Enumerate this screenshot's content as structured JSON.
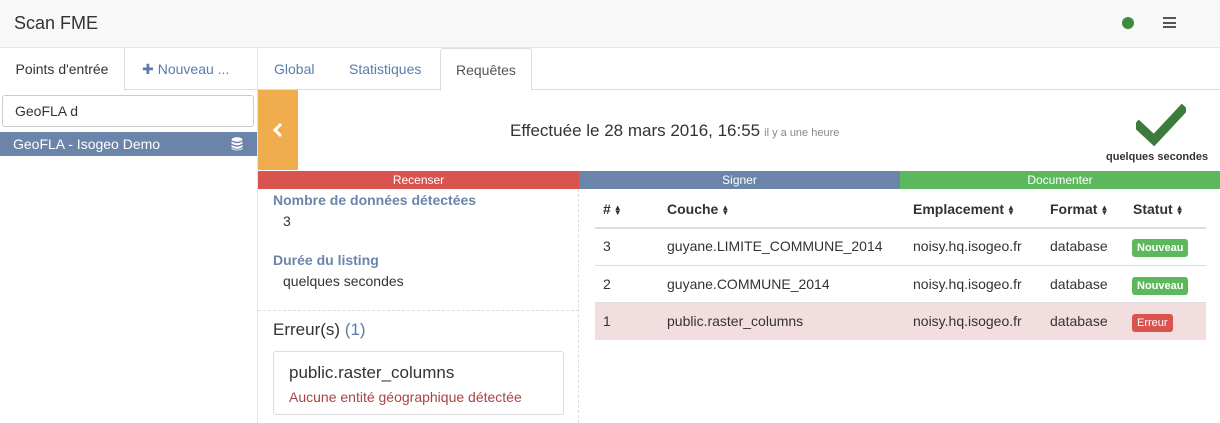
{
  "app": {
    "title": "Scan FME"
  },
  "sidebar": {
    "tabs": [
      {
        "label": "Points d'entrée"
      },
      {
        "label": "Nouveau ..."
      }
    ],
    "search": {
      "value": "GeoFLA d"
    },
    "items": [
      {
        "label": "GeoFLA - Isogeo Demo"
      }
    ]
  },
  "tabs": [
    {
      "label": "Global"
    },
    {
      "label": "Statistiques"
    },
    {
      "label": "Requêtes"
    }
  ],
  "banner": {
    "title": "Effectuée le 28 mars 2016, 16:55",
    "ago": "il y a une heure",
    "duration": "quelques secondes"
  },
  "steps": [
    {
      "label": "Recenser",
      "color": "#d9534f"
    },
    {
      "label": "Signer",
      "color": "#6b85aa"
    },
    {
      "label": "Documenter",
      "color": "#5cb85c"
    }
  ],
  "details": {
    "detected_label": "Nombre de données détectées",
    "detected_value": "3",
    "listing_label": "Durée du listing",
    "listing_value": "quelques secondes"
  },
  "errors": {
    "heading": "Erreur(s)",
    "count": "(1)",
    "items": [
      {
        "title": "public.raster_columns",
        "message": "Aucune entité géographique détectée"
      }
    ]
  },
  "table": {
    "headers": [
      "#",
      "Couche",
      "Emplacement",
      "Format",
      "Statut"
    ],
    "rows": [
      {
        "num": "3",
        "layer": "guyane.LIMITE_COMMUNE_2014",
        "location": "noisy.hq.isogeo.fr",
        "format": "database",
        "status": "Nouveau"
      },
      {
        "num": "2",
        "layer": "guyane.COMMUNE_2014",
        "location": "noisy.hq.isogeo.fr",
        "format": "database",
        "status": "Nouveau"
      },
      {
        "num": "1",
        "layer": "public.raster_columns",
        "location": "noisy.hq.isogeo.fr",
        "format": "database",
        "status": "Erreur"
      }
    ]
  },
  "colors": {
    "accent": "#6b85aa",
    "warning": "#f0ad4e",
    "success": "#5cb85c",
    "danger": "#d9534f",
    "status_connected": "#3d8b3d"
  }
}
